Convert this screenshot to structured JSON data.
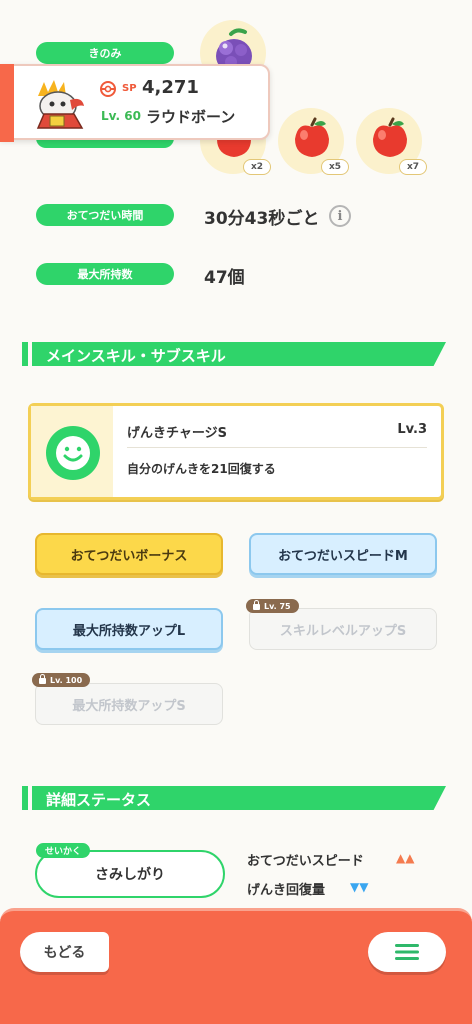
{
  "ingredients": {
    "label": "きのみ",
    "counts": [
      "x2",
      "x5",
      "x7"
    ]
  },
  "pokemon_card": {
    "sp_label": "SP",
    "sp_value": "4,271",
    "level": "Lv. 60",
    "name": "ラウドボーン"
  },
  "stats": {
    "help_time_label": "おてつだい時間",
    "help_time_value": "30分43秒ごと",
    "max_carry_label": "最大所持数",
    "max_carry_value": "47個"
  },
  "skills_section": {
    "title": "メインスキル・サブスキル",
    "main_skill": {
      "name": "げんきチャージS",
      "level": "Lv.3",
      "description": "自分のげんきを21回復する"
    },
    "sub_skills": [
      {
        "label": "おてつだいボーナス",
        "style": "gold"
      },
      {
        "label": "おてつだいスピードM",
        "style": "blue"
      },
      {
        "label": "最大所持数アップL",
        "style": "blue"
      },
      {
        "label": "スキルレベルアップS",
        "style": "locked",
        "lock_level": "Lv. 75"
      },
      {
        "label": "最大所持数アップS",
        "style": "locked",
        "lock_level": "Lv. 100"
      }
    ]
  },
  "details_section": {
    "title": "詳細ステータス",
    "nature_tag": "せいかく",
    "nature_value": "さみしがり",
    "up_stat": "おてつだいスピード",
    "down_stat": "げんき回復量",
    "up_arrows": "▲▲",
    "down_arrows": "▼▼"
  },
  "footer": {
    "back_label": "もどる"
  },
  "colors": {
    "green": "#2fd46a",
    "footer": "#f7684a",
    "gold": "#fcd84a",
    "blue": "#d8efff",
    "up": "#f47b4f",
    "down": "#3aa6f0"
  }
}
